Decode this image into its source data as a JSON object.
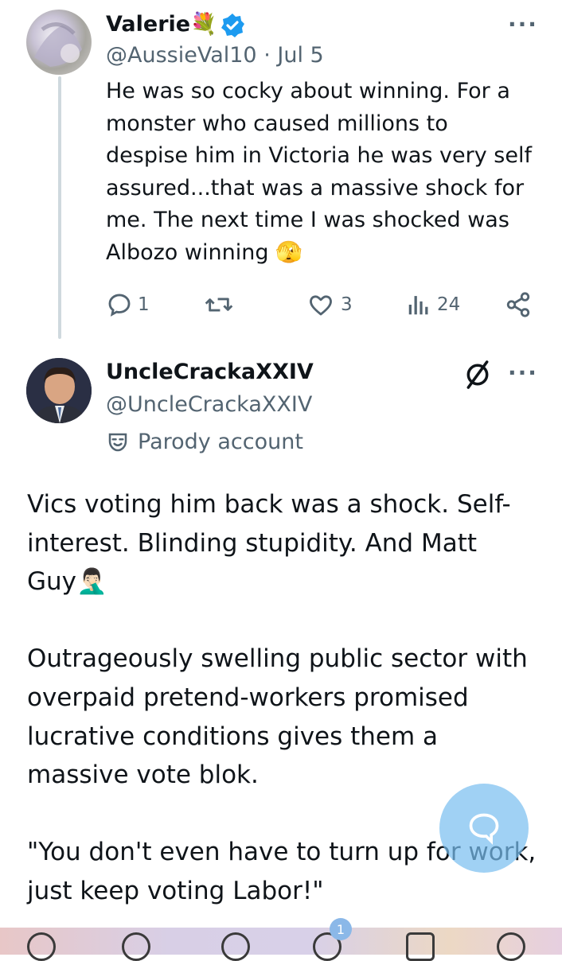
{
  "tweet1": {
    "name": "Valerie",
    "emoji": "💐",
    "handle": "@AussieVal10",
    "sep": "·",
    "date": "Jul 5",
    "more": "···",
    "lines": [
      "He was so cocky about winning. For a",
      "monster who caused millions to",
      "despise him in Victoria he was very self",
      "assured...that was a massive shock for",
      "me. The next time I was shocked was"
    ],
    "last_line": "Albozo winning",
    "last_emoji": "🫣",
    "actions": {
      "replies": "1",
      "likes": "3",
      "views": "24"
    }
  },
  "tweet2": {
    "name": "UncleCrackaXXIV",
    "handle": "@UncleCrackaXXIV",
    "more": "···",
    "parody_label": "Parody account",
    "para1_lines": [
      "Vics voting him back was a shock. Self-",
      "interest. Blinding stupidity. And Matt"
    ],
    "para1_last": "Guy",
    "para1_emoji": "🤦🏻‍♂️",
    "para2_lines": [
      "Outrageously swelling public sector with",
      "overpaid pretend-workers promised",
      "lucrative conditions gives them a",
      "massive vote blok."
    ],
    "para3_lines": [
      "\"You don't even have to turn up for work,",
      "just keep voting Labor!\""
    ]
  },
  "nav": {
    "notification_count": "1"
  },
  "colors": {
    "verified": "#1d9bf0",
    "secondary_text": "#536471",
    "fab": "#78bef0"
  },
  "icons": [
    "verified-badge-icon",
    "more-icon",
    "reply-icon",
    "retweet-icon",
    "like-icon",
    "views-icon",
    "share-icon",
    "grok-slash-icon",
    "parody-mask-icon",
    "compose-message-icon"
  ]
}
